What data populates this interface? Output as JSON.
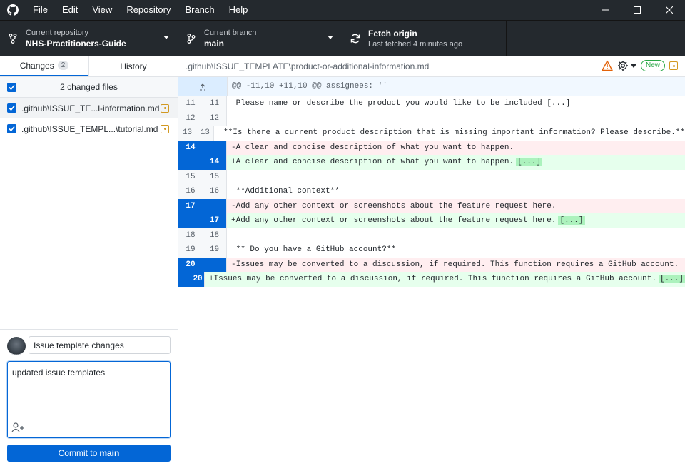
{
  "menu": [
    "File",
    "Edit",
    "View",
    "Repository",
    "Branch",
    "Help"
  ],
  "toolbar": {
    "repo_label": "Current repository",
    "repo_value": "NHS-Practitioners-Guide",
    "branch_label": "Current branch",
    "branch_value": "main",
    "fetch_label": "Fetch origin",
    "fetch_sub": "Last fetched 4 minutes ago"
  },
  "tabs": {
    "changes": "Changes",
    "changes_count": "2",
    "history": "History"
  },
  "changes": {
    "header": "2 changed files",
    "files": [
      ".github\\ISSUE_TE...l-information.md",
      ".github\\ISSUE_TEMPL...\\tutorial.md"
    ]
  },
  "diff": {
    "path": ".github\\ISSUE_TEMPLATE\\product-or-additional-information.md",
    "new_badge": "New",
    "hunk": "@@ -11,10 +11,10 @@ assignees: ''",
    "rows": [
      {
        "o": "11",
        "n": "11",
        "t": " Please name or describe the product you would like to be included [...]",
        "type": "ctx",
        "ell": ""
      },
      {
        "o": "12",
        "n": "12",
        "t": "",
        "type": "ctx",
        "ell": ""
      },
      {
        "o": "13",
        "n": "13",
        "t": " **Is there a current product description that is missing important information? Please describe.**",
        "type": "ctx",
        "ell": ""
      },
      {
        "o": "14",
        "n": "",
        "t": "-A clear and concise description of what you want to happen.",
        "type": "del",
        "ell": ""
      },
      {
        "o": "",
        "n": "14",
        "t": "+A clear and concise description of what you want to happen.",
        "type": "add",
        "ell": "[...]"
      },
      {
        "o": "15",
        "n": "15",
        "t": "",
        "type": "ctx",
        "ell": ""
      },
      {
        "o": "16",
        "n": "16",
        "t": " **Additional context**",
        "type": "ctx",
        "ell": ""
      },
      {
        "o": "17",
        "n": "",
        "t": "-Add any other context or screenshots about the feature request here.",
        "type": "del",
        "ell": ""
      },
      {
        "o": "",
        "n": "17",
        "t": "+Add any other context or screenshots about the feature request here.",
        "type": "add",
        "ell": "[...]"
      },
      {
        "o": "18",
        "n": "18",
        "t": "",
        "type": "ctx",
        "ell": ""
      },
      {
        "o": "19",
        "n": "19",
        "t": " ** Do you have a GitHub account?**",
        "type": "ctx",
        "ell": ""
      },
      {
        "o": "20",
        "n": "",
        "t": "-Issues may be converted to a discussion, if required. This function requires a GitHub account.",
        "type": "del",
        "ell": ""
      },
      {
        "o": "",
        "n": "20",
        "t": "+Issues may be converted to a discussion, if required. This function requires a GitHub account.",
        "type": "add",
        "ell": "[...]"
      }
    ]
  },
  "commit": {
    "summary": "Issue template changes",
    "description": "updated issue templates",
    "button_prefix": "Commit to",
    "button_branch": "main"
  },
  "colors": {
    "accent": "#0366d6",
    "titlebar": "#24292e",
    "added": "#e6ffed",
    "deleted": "#ffeef0",
    "modified": "#d29922"
  }
}
